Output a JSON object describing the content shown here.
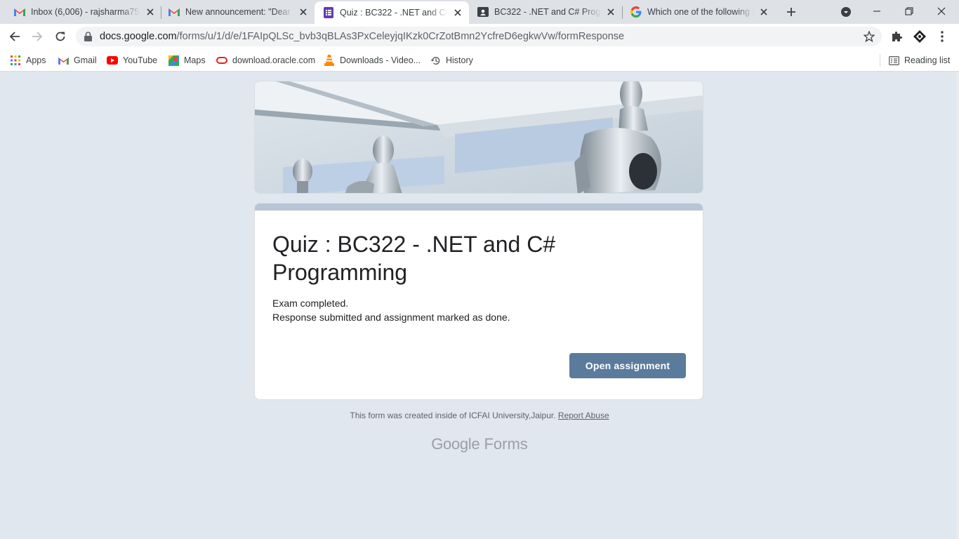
{
  "tabs": [
    {
      "title": "Inbox (6,006) - rajsharma752…",
      "icon": "gmail-icon",
      "active": false
    },
    {
      "title": "New announcement: \"Dear st…",
      "icon": "gmail-icon",
      "active": false
    },
    {
      "title": "Quiz : BC322 - .NET and C# P…",
      "icon": "google-forms-icon",
      "active": true
    },
    {
      "title": "BC322 - .NET and C# Program…",
      "icon": "google-classroom-icon",
      "active": false
    },
    {
      "title": "Which one of the following is…",
      "icon": "google-icon",
      "active": false
    }
  ],
  "address_bar": {
    "host": "docs.google.com",
    "path": "/forms/u/1/d/e/1FAIpQLSc_bvb3qBLAs3PxCeleyjqIKzk0CrZotBmn2YcfreD6egkwVw/formResponse"
  },
  "bookmarks": [
    {
      "label": "Apps",
      "icon": "apps-grid-icon"
    },
    {
      "label": "Gmail",
      "icon": "gmail-icon"
    },
    {
      "label": "YouTube",
      "icon": "youtube-icon"
    },
    {
      "label": "Maps",
      "icon": "maps-icon"
    },
    {
      "label": "download.oracle.com",
      "icon": "oracle-icon"
    },
    {
      "label": "Downloads - Video...",
      "icon": "vlc-icon"
    },
    {
      "label": "History",
      "icon": "history-icon"
    }
  ],
  "reading_list": "Reading list",
  "form": {
    "title": "Quiz : BC322 - .NET and C# Programming",
    "message_line1": "Exam completed.",
    "message_line2": "Response submitted and assignment marked as done.",
    "button_label": "Open assignment"
  },
  "footer": {
    "text": "This form was created inside of ICFAI University,Jaipur.",
    "report_link": "Report Abuse"
  },
  "brand": {
    "google": "Google",
    "forms": "Forms"
  },
  "colors": {
    "accent": "#5a7b9c",
    "page_bg": "#e1e7ef",
    "card_topbar": "#b7c5d6"
  }
}
